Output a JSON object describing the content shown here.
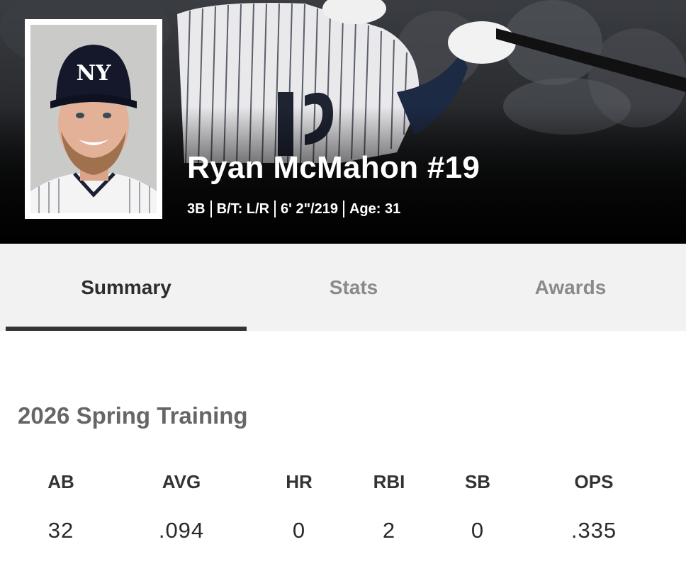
{
  "player": {
    "name": "Ryan McMahon #19",
    "position": "3B",
    "bats_throws": "B/T: L/R",
    "height_weight": "6' 2\"/219",
    "age": "Age: 31",
    "cap_logo": "NY"
  },
  "tabs": [
    {
      "label": "Summary",
      "active": true
    },
    {
      "label": "Stats",
      "active": false
    },
    {
      "label": "Awards",
      "active": false
    }
  ],
  "summary": {
    "section_title": "2026 Spring Training",
    "columns": [
      "AB",
      "AVG",
      "HR",
      "RBI",
      "SB",
      "OPS"
    ],
    "values": [
      "32",
      ".094",
      "0",
      "2",
      "0",
      ".335"
    ]
  },
  "colors": {
    "hero_dark": "#0a0a0b",
    "tab_background": "#f2f2f2",
    "active_tab_text": "#2d2d2d",
    "inactive_tab_text": "#8a8a8a",
    "tab_indicator": "#333333",
    "section_title": "#666666"
  }
}
